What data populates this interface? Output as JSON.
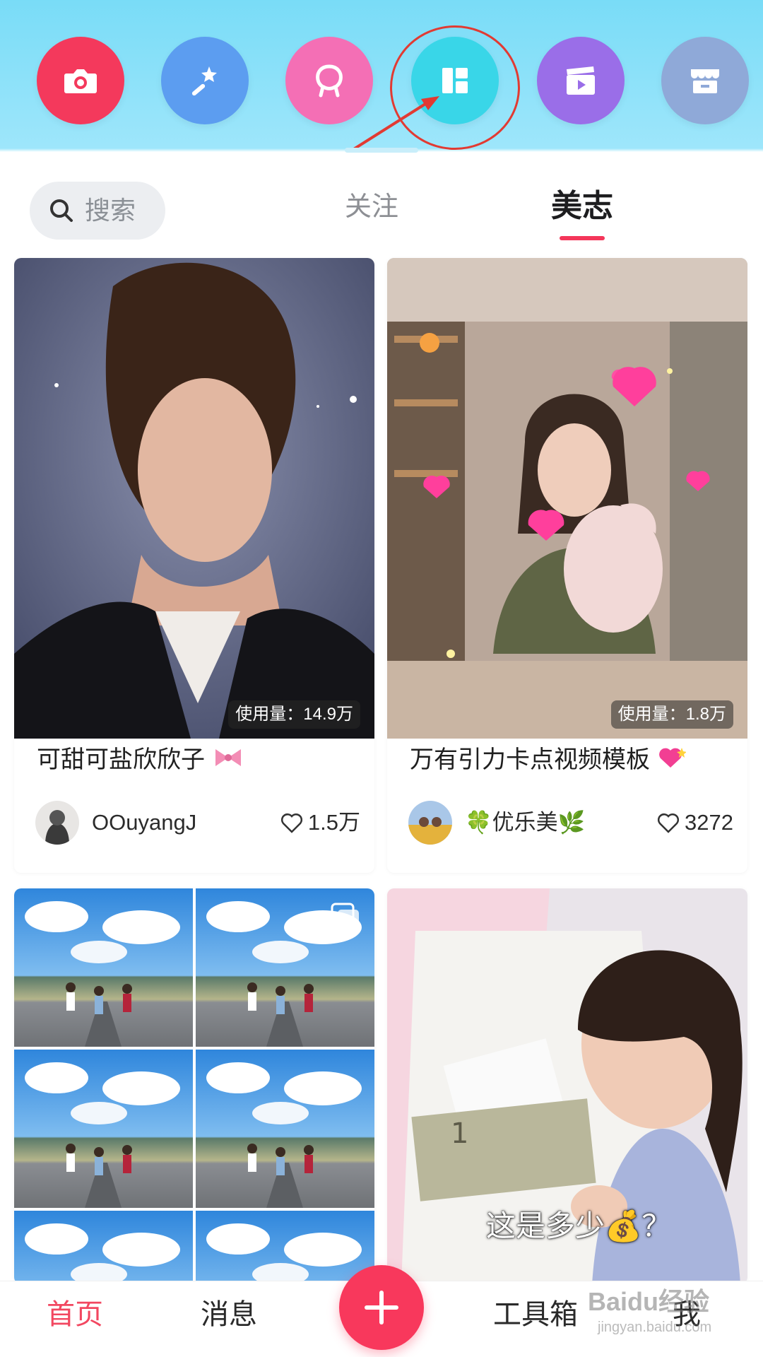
{
  "tools": [
    {
      "icon": "camera-icon",
      "color": "#f4395c"
    },
    {
      "icon": "magic-wand-icon",
      "color": "#5c9df0"
    },
    {
      "icon": "face-outline-icon",
      "color": "#f46fb5"
    },
    {
      "icon": "layout-grid-icon",
      "color": "#39d6e8"
    },
    {
      "icon": "video-clapper-icon",
      "color": "#9a6ee8"
    },
    {
      "icon": "store-icon",
      "color": "#8fa9d8"
    }
  ],
  "header": {
    "search_placeholder": "搜索",
    "tab_follow": "关注",
    "tab_meizhi": "美志",
    "accent_color": "#f4365a"
  },
  "feed": {
    "cards": [
      {
        "usage": "使用量：14.9万",
        "title": "可甜可盐欣欣子",
        "title_emoji": "bow-icon",
        "author": "OOuyangJ",
        "likes": "1.5万"
      },
      {
        "usage": "使用量：1.8万",
        "title": "万有引力卡点视频模板",
        "title_emoji": "heart-sparkle-icon",
        "author": "🍀优乐美🌿",
        "likes": "3272"
      },
      {
        "type": "photo-grid",
        "multi_icon": "multi-image-icon"
      },
      {
        "caption": "这是多少💰？"
      }
    ]
  },
  "bottom_nav": {
    "home": "首页",
    "messages": "消息",
    "add": "+",
    "toolbox": "工具箱",
    "me": "我"
  },
  "watermark": {
    "line1": "Baidu经验",
    "line2": "jingyan.baidu.com"
  }
}
